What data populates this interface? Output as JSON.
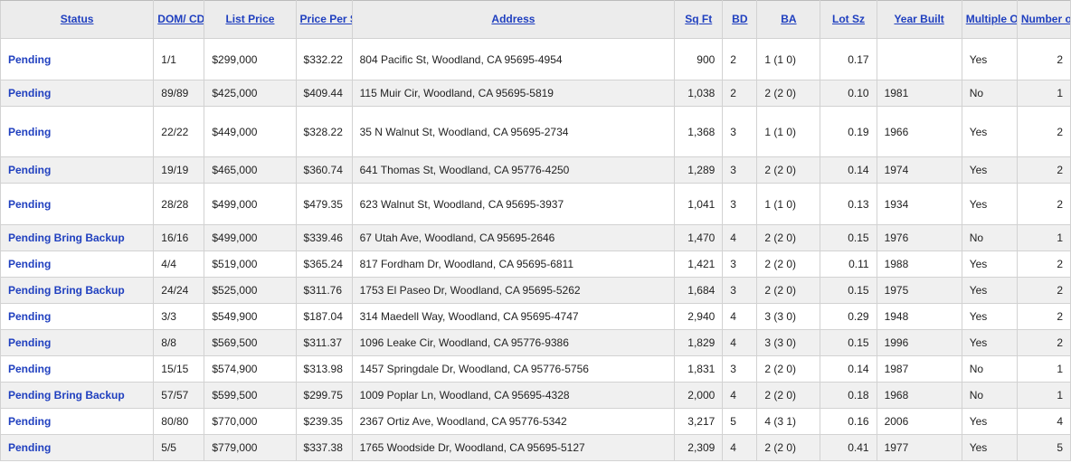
{
  "colors": {
    "link": "#1f3fbf",
    "header_bg": "#ececec",
    "row_alt": "#f0f0f0",
    "border": "#d2d2d2"
  },
  "columns": [
    {
      "key": "status",
      "label": "Status"
    },
    {
      "key": "dom",
      "label": "DOM/ CDOM"
    },
    {
      "key": "list_price",
      "label": "List Price"
    },
    {
      "key": "price_per_sqft",
      "label": "Price Per Sq Ft"
    },
    {
      "key": "address",
      "label": "Address"
    },
    {
      "key": "sqft",
      "label": "Sq Ft"
    },
    {
      "key": "bd",
      "label": "BD"
    },
    {
      "key": "ba",
      "label": "BA"
    },
    {
      "key": "lot_sz",
      "label": "Lot Sz"
    },
    {
      "key": "year_built",
      "label": "Year Built"
    },
    {
      "key": "multiple_offers",
      "label": "Multiple Offers"
    },
    {
      "key": "number_of_offers",
      "label": "Number of Offers"
    }
  ],
  "rows": [
    {
      "status": "Pending",
      "dom": "1/1",
      "list_price": "$299,000",
      "price_per_sqft": "$332.22",
      "address": "804 Pacific St, Woodland, CA 95695-4954",
      "sqft": "900",
      "bd": "2",
      "ba": "1 (1 0)",
      "lot_sz": "0.17",
      "year_built": "",
      "multiple_offers": "Yes",
      "number_of_offers": "2"
    },
    {
      "status": "Pending",
      "dom": "89/89",
      "list_price": "$425,000",
      "price_per_sqft": "$409.44",
      "address": "115 Muir Cir, Woodland, CA 95695-5819",
      "sqft": "1,038",
      "bd": "2",
      "ba": "2 (2 0)",
      "lot_sz": "0.10",
      "year_built": "1981",
      "multiple_offers": "No",
      "number_of_offers": "1"
    },
    {
      "status": "Pending",
      "dom": "22/22",
      "list_price": "$449,000",
      "price_per_sqft": "$328.22",
      "address": "35 N Walnut St, Woodland, CA 95695-2734",
      "sqft": "1,368",
      "bd": "3",
      "ba": "1 (1 0)",
      "lot_sz": "0.19",
      "year_built": "1966",
      "multiple_offers": "Yes",
      "number_of_offers": "2"
    },
    {
      "status": "Pending",
      "dom": "19/19",
      "list_price": "$465,000",
      "price_per_sqft": "$360.74",
      "address": "641 Thomas St, Woodland, CA 95776-4250",
      "sqft": "1,289",
      "bd": "3",
      "ba": "2 (2 0)",
      "lot_sz": "0.14",
      "year_built": "1974",
      "multiple_offers": "Yes",
      "number_of_offers": "2"
    },
    {
      "status": "Pending",
      "dom": "28/28",
      "list_price": "$499,000",
      "price_per_sqft": "$479.35",
      "address": "623 Walnut St, Woodland, CA 95695-3937",
      "sqft": "1,041",
      "bd": "3",
      "ba": "1 (1 0)",
      "lot_sz": "0.13",
      "year_built": "1934",
      "multiple_offers": "Yes",
      "number_of_offers": "2"
    },
    {
      "status": "Pending Bring Backup",
      "dom": "16/16",
      "list_price": "$499,000",
      "price_per_sqft": "$339.46",
      "address": "67 Utah Ave, Woodland, CA 95695-2646",
      "sqft": "1,470",
      "bd": "4",
      "ba": "2 (2 0)",
      "lot_sz": "0.15",
      "year_built": "1976",
      "multiple_offers": "No",
      "number_of_offers": "1"
    },
    {
      "status": "Pending",
      "dom": "4/4",
      "list_price": "$519,000",
      "price_per_sqft": "$365.24",
      "address": "817 Fordham Dr, Woodland, CA 95695-6811",
      "sqft": "1,421",
      "bd": "3",
      "ba": "2 (2 0)",
      "lot_sz": "0.11",
      "year_built": "1988",
      "multiple_offers": "Yes",
      "number_of_offers": "2"
    },
    {
      "status": "Pending Bring Backup",
      "dom": "24/24",
      "list_price": "$525,000",
      "price_per_sqft": "$311.76",
      "address": "1753 El Paseo Dr, Woodland, CA 95695-5262",
      "sqft": "1,684",
      "bd": "3",
      "ba": "2 (2 0)",
      "lot_sz": "0.15",
      "year_built": "1975",
      "multiple_offers": "Yes",
      "number_of_offers": "2"
    },
    {
      "status": "Pending",
      "dom": "3/3",
      "list_price": "$549,900",
      "price_per_sqft": "$187.04",
      "address": "314 Maedell Way, Woodland, CA 95695-4747",
      "sqft": "2,940",
      "bd": "4",
      "ba": "3 (3 0)",
      "lot_sz": "0.29",
      "year_built": "1948",
      "multiple_offers": "Yes",
      "number_of_offers": "2"
    },
    {
      "status": "Pending",
      "dom": "8/8",
      "list_price": "$569,500",
      "price_per_sqft": "$311.37",
      "address": "1096 Leake Cir, Woodland, CA 95776-9386",
      "sqft": "1,829",
      "bd": "4",
      "ba": "3 (3 0)",
      "lot_sz": "0.15",
      "year_built": "1996",
      "multiple_offers": "Yes",
      "number_of_offers": "2"
    },
    {
      "status": "Pending",
      "dom": "15/15",
      "list_price": "$574,900",
      "price_per_sqft": "$313.98",
      "address": "1457 Springdale Dr, Woodland, CA 95776-5756",
      "sqft": "1,831",
      "bd": "3",
      "ba": "2 (2 0)",
      "lot_sz": "0.14",
      "year_built": "1987",
      "multiple_offers": "No",
      "number_of_offers": "1"
    },
    {
      "status": "Pending Bring Backup",
      "dom": "57/57",
      "list_price": "$599,500",
      "price_per_sqft": "$299.75",
      "address": "1009 Poplar Ln, Woodland, CA 95695-4328",
      "sqft": "2,000",
      "bd": "4",
      "ba": "2 (2 0)",
      "lot_sz": "0.18",
      "year_built": "1968",
      "multiple_offers": "No",
      "number_of_offers": "1"
    },
    {
      "status": "Pending",
      "dom": "80/80",
      "list_price": "$770,000",
      "price_per_sqft": "$239.35",
      "address": "2367 Ortiz Ave, Woodland, CA 95776-5342",
      "sqft": "3,217",
      "bd": "5",
      "ba": "4 (3 1)",
      "lot_sz": "0.16",
      "year_built": "2006",
      "multiple_offers": "Yes",
      "number_of_offers": "4"
    },
    {
      "status": "Pending",
      "dom": "5/5",
      "list_price": "$779,000",
      "price_per_sqft": "$337.38",
      "address": "1765 Woodside Dr, Woodland, CA 95695-5127",
      "sqft": "2,309",
      "bd": "4",
      "ba": "2 (2 0)",
      "lot_sz": "0.41",
      "year_built": "1977",
      "multiple_offers": "Yes",
      "number_of_offers": "5"
    }
  ]
}
